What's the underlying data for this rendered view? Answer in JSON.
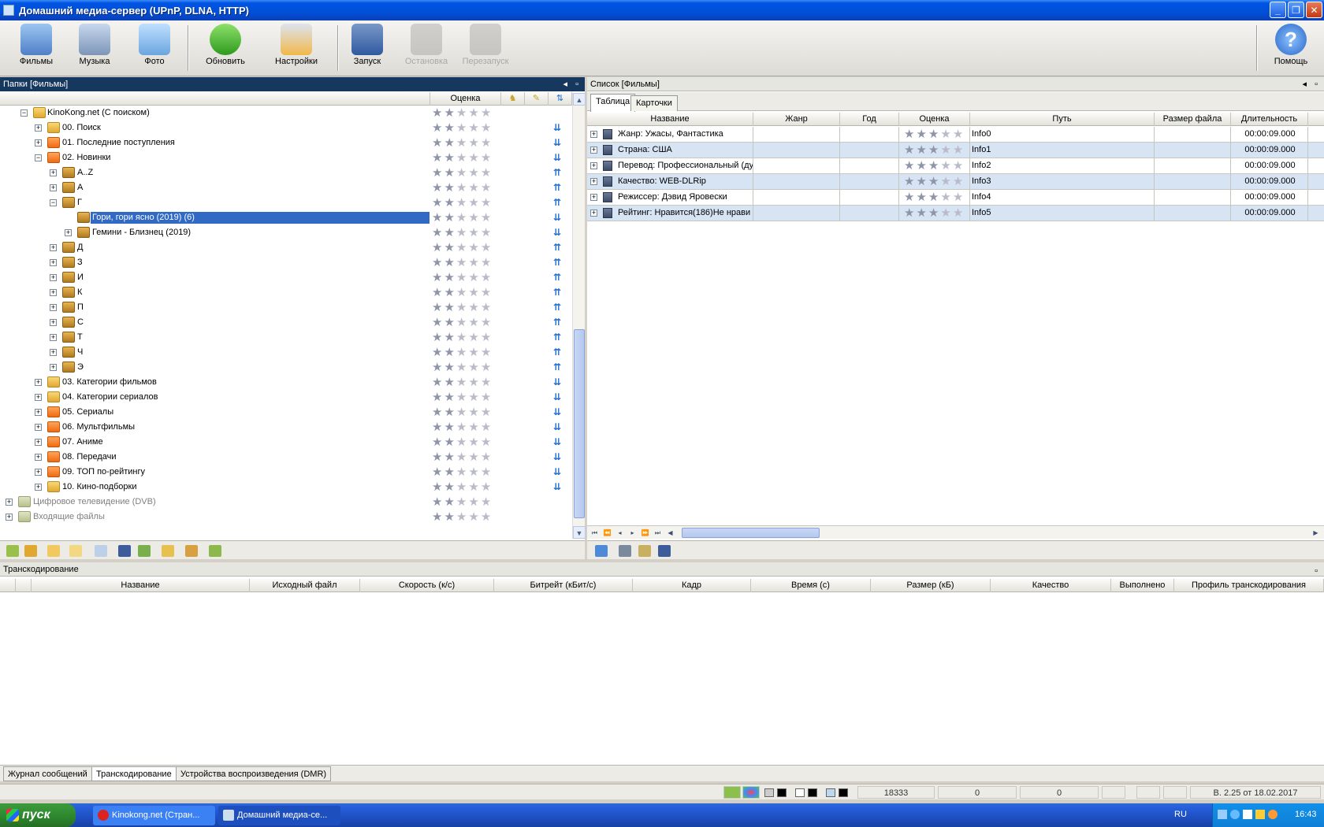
{
  "window": {
    "title": "Домашний медиа-сервер (UPnP, DLNA, HTTP)"
  },
  "toolbar": {
    "buttons": [
      {
        "label": "Фильмы"
      },
      {
        "label": "Музыка"
      },
      {
        "label": "Фото"
      },
      {
        "label": "Обновить"
      },
      {
        "label": "Настройки"
      },
      {
        "label": "Запуск"
      },
      {
        "label": "Остановка"
      },
      {
        "label": "Перезапуск"
      },
      {
        "label": "Помощь"
      }
    ]
  },
  "folders": {
    "header": "Папки [Фильмы]",
    "rating_col": "Оценка",
    "tree": [
      {
        "label": "KinoKong.net (С поиском)",
        "rating": 2
      },
      {
        "label": "00. Поиск",
        "rating": 2
      },
      {
        "label": "01. Последние поступления",
        "rating": 2
      },
      {
        "label": "02. Новинки",
        "rating": 2
      },
      {
        "label": "A..Z",
        "rating": 2
      },
      {
        "label": "А",
        "rating": 2
      },
      {
        "label": "Г",
        "rating": 2
      },
      {
        "label": "Гори, гори ясно (2019) (6)",
        "rating": 2
      },
      {
        "label": "Гемини - Близнец (2019)",
        "rating": 2
      },
      {
        "label": "Д",
        "rating": 2
      },
      {
        "label": "З",
        "rating": 2
      },
      {
        "label": "И",
        "rating": 2
      },
      {
        "label": "К",
        "rating": 2
      },
      {
        "label": "П",
        "rating": 2
      },
      {
        "label": "С",
        "rating": 2
      },
      {
        "label": "Т",
        "rating": 2
      },
      {
        "label": "Ч",
        "rating": 2
      },
      {
        "label": "Э",
        "rating": 2
      },
      {
        "label": "03. Категории фильмов",
        "rating": 2
      },
      {
        "label": "04. Категории сериалов",
        "rating": 2
      },
      {
        "label": "05. Сериалы",
        "rating": 2
      },
      {
        "label": "06. Мультфильмы",
        "rating": 2
      },
      {
        "label": "07. Аниме",
        "rating": 2
      },
      {
        "label": "08. Передачи",
        "rating": 2
      },
      {
        "label": "09. ТОП по-рейтингу",
        "rating": 2
      },
      {
        "label": "10. Кино-подборки",
        "rating": 2
      },
      {
        "label": "Цифровое телевидение (DVB)",
        "rating": 2
      },
      {
        "label": "Входящие файлы",
        "rating": 2
      }
    ]
  },
  "list": {
    "header": "Список [Фильмы]",
    "tabs": [
      "Таблица",
      "Карточки"
    ],
    "columns": [
      "Название",
      "Жанр",
      "Год",
      "Оценка",
      "Путь",
      "Размер файла",
      "Длительность"
    ],
    "rows": [
      {
        "name": "Жанр: Ужасы, Фантастика",
        "path": "Info0",
        "duration": "00:00:09.000",
        "rating": 3
      },
      {
        "name": "Страна: США",
        "path": "Info1",
        "duration": "00:00:09.000",
        "rating": 3
      },
      {
        "name": "Перевод: Профессиональный (ду",
        "path": "Info2",
        "duration": "00:00:09.000",
        "rating": 3
      },
      {
        "name": "Качество: WEB-DLRip",
        "path": "Info3",
        "duration": "00:00:09.000",
        "rating": 3
      },
      {
        "name": "Режиссер: Дэвид Яровески",
        "path": "Info4",
        "duration": "00:00:09.000",
        "rating": 3
      },
      {
        "name": "Рейтинг: Нравится(186)Не нрави",
        "path": "Info5",
        "duration": "00:00:09.000",
        "rating": 3
      }
    ]
  },
  "transcoding": {
    "header": "Транскодирование",
    "columns": [
      "Название",
      "Исходный файл",
      "Скорость (к/с)",
      "Битрейт (кБит/с)",
      "Кадр",
      "Время (с)",
      "Размер (кБ)",
      "Качество",
      "Выполнено",
      "Профиль транскодирования"
    ]
  },
  "bottom_tabs": [
    "Журнал сообщений",
    "Транскодирование",
    "Устройства воспроизведения (DMR)"
  ],
  "statusbar": {
    "count": "18333",
    "val1": "0",
    "val2": "0",
    "version": "В. 2.25 от 18.02.2017"
  },
  "taskbar": {
    "start": "пуск",
    "tasks": [
      "Kinokong.net (Стран...",
      "Домашний медиа-се..."
    ],
    "lang": "RU",
    "clock": "16:43"
  }
}
